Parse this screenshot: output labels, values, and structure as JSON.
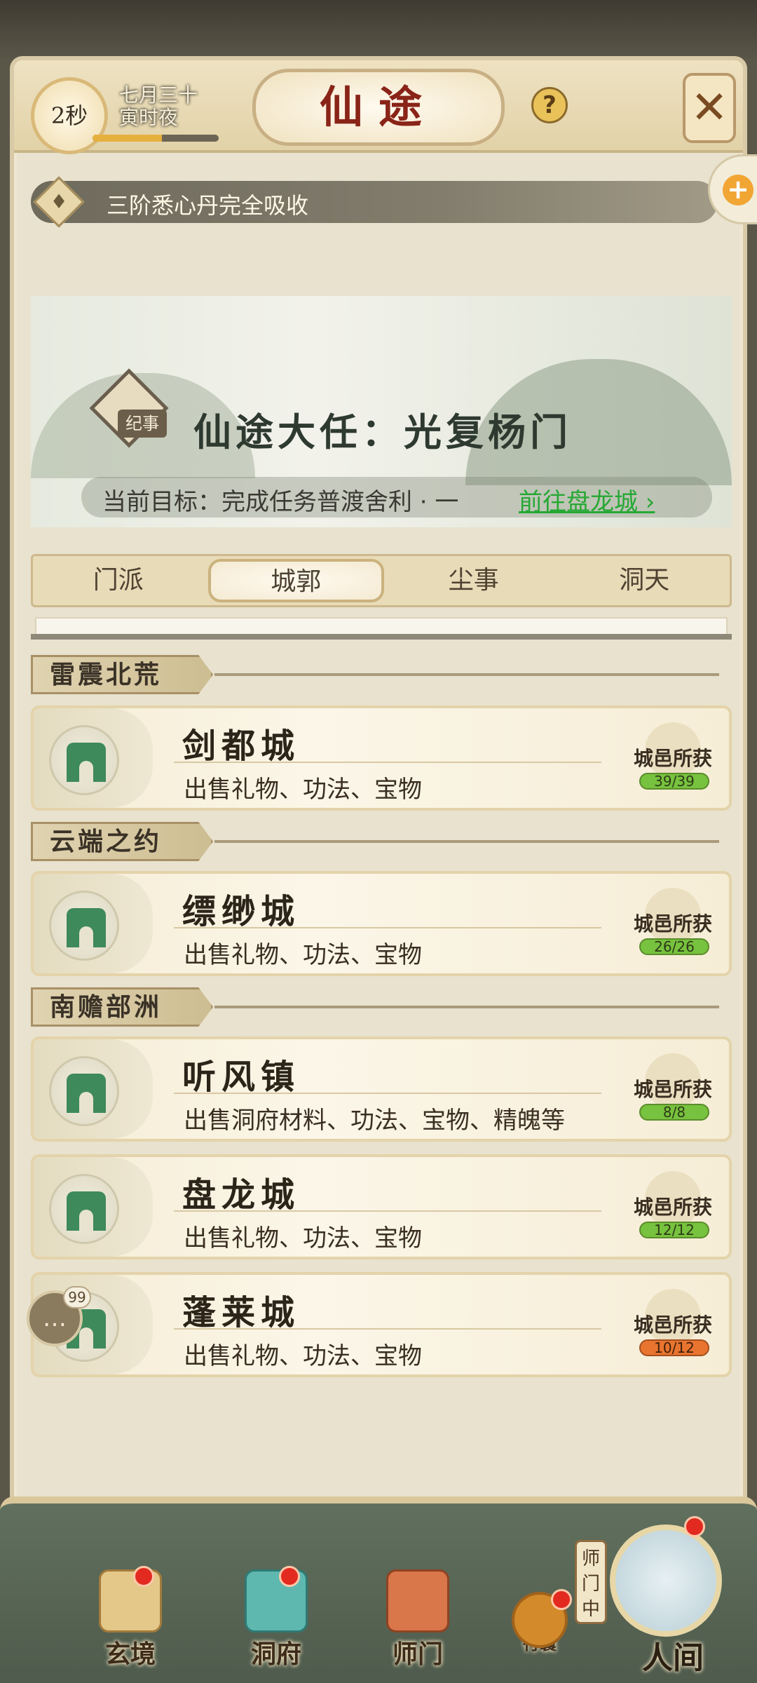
{
  "header": {
    "timer": "2秒",
    "date_line1": "七月三十",
    "date_line2": "寅时夜",
    "progress": 0.55,
    "title": "仙途",
    "help_icon": "question-icon",
    "close_icon": "close-icon"
  },
  "notice": {
    "text": "三阶悉心丹完全吸收",
    "icon": "bell-icon"
  },
  "side_button": {
    "icon": "plus-icon",
    "symbol": "+"
  },
  "quest": {
    "badge": "纪事",
    "title": "仙途大任：光复杨门",
    "goal": "当前目标：完成任务普渡舍利 · 一",
    "link": "前往盘龙城"
  },
  "tabs": [
    {
      "label": "门派",
      "active": false
    },
    {
      "label": "城郭",
      "active": true
    },
    {
      "label": "尘事",
      "active": false
    },
    {
      "label": "洞天",
      "active": false
    }
  ],
  "regions": [
    {
      "label": "雷震北荒"
    },
    {
      "label": "云端之约"
    },
    {
      "label": "南赡部洲"
    }
  ],
  "gain_label": "城邑所获",
  "cities": [
    {
      "name": "剑都城",
      "desc": "出售礼物、功法、宝物",
      "count": "39/39"
    },
    {
      "name": "缥缈城",
      "desc": "出售礼物、功法、宝物",
      "count": "26/26"
    },
    {
      "name": "听风镇",
      "desc": "出售洞府材料、功法、宝物、精魄等",
      "count": "8/8"
    },
    {
      "name": "盘龙城",
      "desc": "出售礼物、功法、宝物",
      "count": "12/12"
    },
    {
      "name": "蓬莱城",
      "desc": "出售礼物、功法、宝物",
      "count": "10/12"
    }
  ],
  "chat": {
    "badge": "99",
    "icon": "chat-icon"
  },
  "bottom_nav": {
    "items": [
      {
        "label": "玄境",
        "icon": "scroll-icon"
      },
      {
        "label": "洞府",
        "icon": "lantern-icon"
      },
      {
        "label": "师门",
        "icon": "banner-icon"
      }
    ],
    "bag": "行囊",
    "sect_tag": "师门中",
    "world": "人间"
  },
  "colors": {
    "title_red": "#8a2418",
    "link_green": "#26a834",
    "badge_red": "#e22a20",
    "count_full": "#77c23e",
    "count_partial": "#e8742f"
  }
}
